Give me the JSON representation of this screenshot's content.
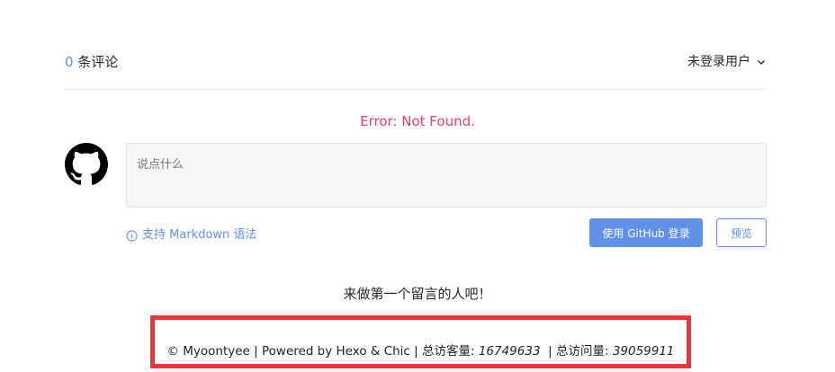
{
  "comments": {
    "count": "0",
    "count_suffix": " 条评论",
    "user_menu_label": "未登录用户"
  },
  "error_message": "Error: Not Found.",
  "editor": {
    "placeholder": "说点什么",
    "markdown_tip": "支持 Markdown 语法",
    "login_button": "使用 GitHub 登录",
    "preview_button": "预览"
  },
  "empty_message": "来做第一个留言的人吧！",
  "footer": {
    "copyright": "© Myoontyee | Powered by Hexo & Chic | 总访客量: ",
    "visitors": "16749633",
    "views_label": "  | 总访问量: ",
    "views": "39059911"
  },
  "colors": {
    "accent": "#6190e8",
    "error": "#e6416b",
    "highlight_border": "#ee3438"
  },
  "icons": {
    "avatar": "github-octocat-icon",
    "user_menu": "chevron-down-icon",
    "tip": "info-icon"
  }
}
